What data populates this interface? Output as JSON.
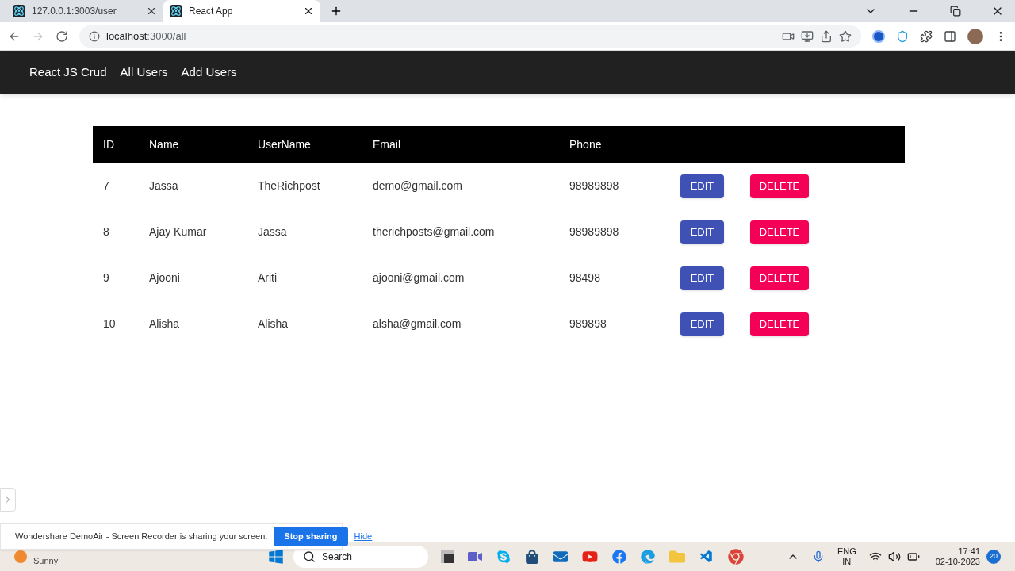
{
  "browser": {
    "tabs": [
      {
        "title": "127.0.0.1:3003/user",
        "selected": false
      },
      {
        "title": "React App",
        "selected": true
      }
    ],
    "url_host": "localhost",
    "url_path": ":3000/all"
  },
  "navbar": {
    "brand": "React JS Crud",
    "links": [
      "All Users",
      "Add Users"
    ]
  },
  "table": {
    "columns": [
      "ID",
      "Name",
      "UserName",
      "Email",
      "Phone"
    ],
    "rows": [
      {
        "cells": [
          "7",
          "Jassa",
          "TheRichpost",
          "demo@gmail.com",
          "98989898"
        ],
        "edit": "EDIT",
        "delete": "DELETE"
      },
      {
        "cells": [
          "8",
          "Ajay Kumar",
          "Jassa",
          "therichposts@gmail.com",
          "98989898"
        ],
        "edit": "EDIT",
        "delete": "DELETE"
      },
      {
        "cells": [
          "9",
          "Ajooni",
          "Ariti",
          "ajooni@gmail.com",
          "98498"
        ],
        "edit": "EDIT",
        "delete": "DELETE"
      },
      {
        "cells": [
          "10",
          "Alisha",
          "Alisha",
          "alsha@gmail.com",
          "989898"
        ],
        "edit": "EDIT",
        "delete": "DELETE"
      }
    ]
  },
  "share_bar": {
    "message": "Wondershare DemoAir - Screen Recorder is sharing your screen.",
    "stop": "Stop sharing",
    "hide": "Hide"
  },
  "taskbar": {
    "weather": "Sunny",
    "search": "Search",
    "lang": "ENG",
    "region": "IN",
    "time": "17:41",
    "date": "02-10-2023",
    "notifications": "20"
  }
}
